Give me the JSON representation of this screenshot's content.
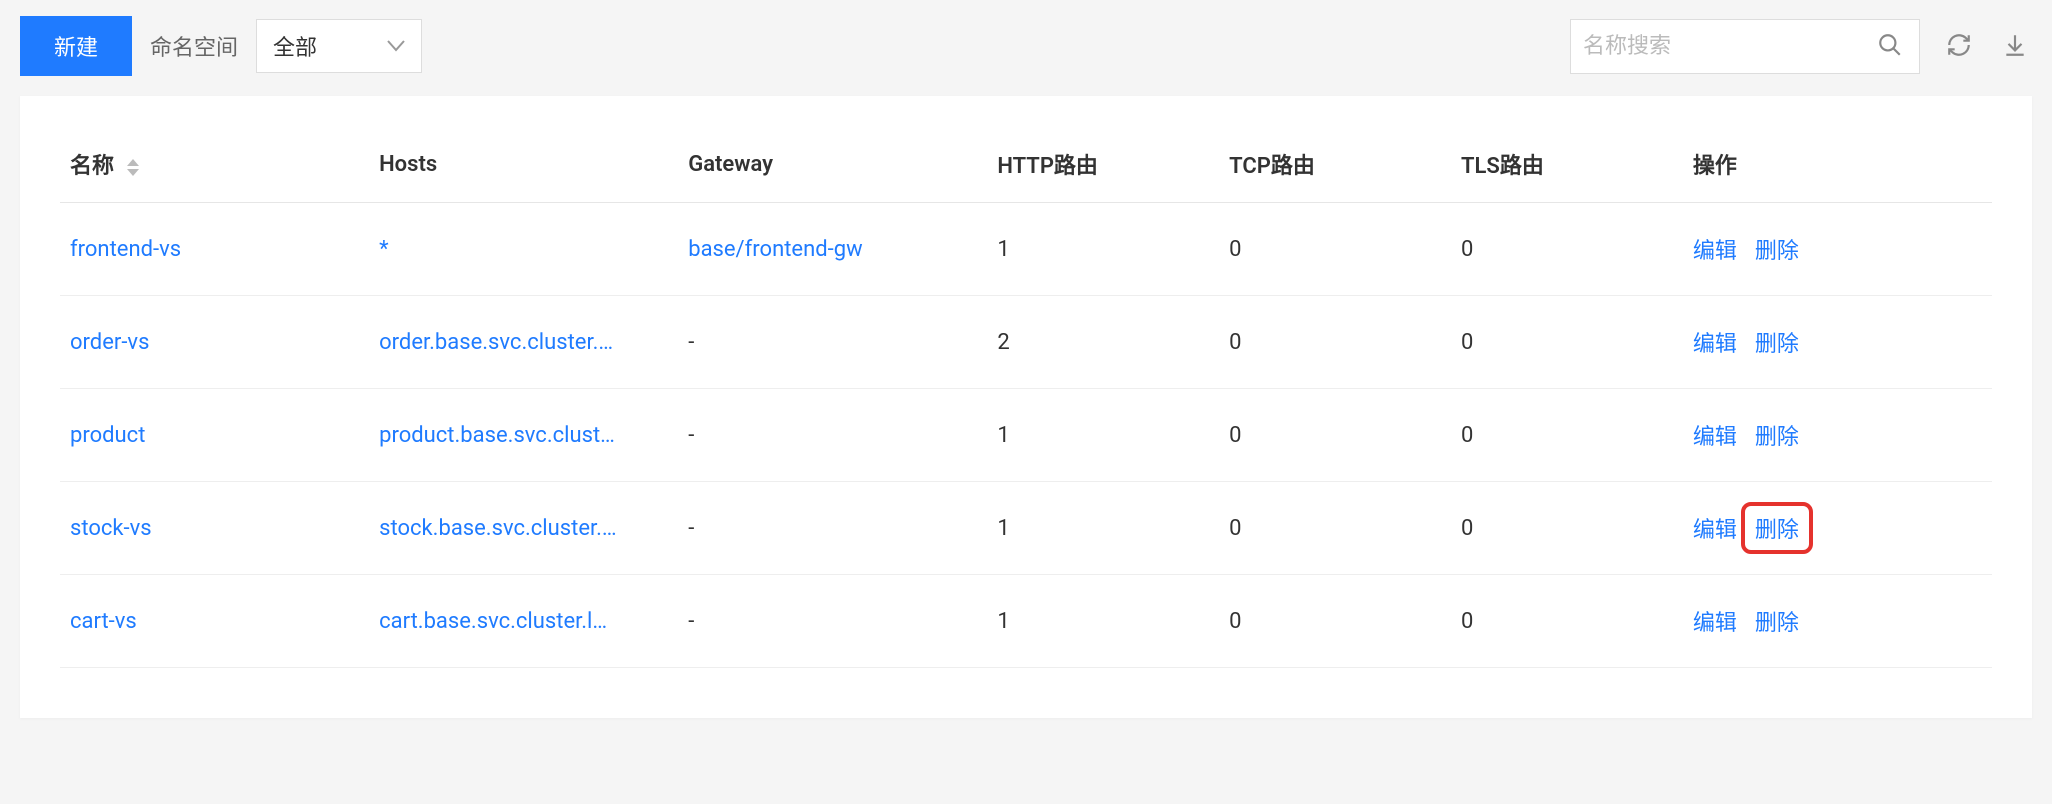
{
  "toolbar": {
    "new_button": "新建",
    "namespace_label": "命名空间",
    "namespace_value": "全部",
    "search_placeholder": "名称搜索"
  },
  "table": {
    "headers": {
      "name": "名称",
      "hosts": "Hosts",
      "gateway": "Gateway",
      "http": "HTTP路由",
      "tcp": "TCP路由",
      "tls": "TLS路由",
      "ops": "操作"
    },
    "actions": {
      "edit": "编辑",
      "delete": "删除"
    },
    "rows": [
      {
        "name": "frontend-vs",
        "hosts": "*",
        "gateway": "base/frontend-gw",
        "gateway_link": true,
        "http": "1",
        "tcp": "0",
        "tls": "0",
        "highlight_delete": false
      },
      {
        "name": "order-vs",
        "hosts": "order.base.svc.cluster.…",
        "gateway": "-",
        "gateway_link": false,
        "http": "2",
        "tcp": "0",
        "tls": "0",
        "highlight_delete": false
      },
      {
        "name": "product",
        "hosts": "product.base.svc.clust…",
        "gateway": "-",
        "gateway_link": false,
        "http": "1",
        "tcp": "0",
        "tls": "0",
        "highlight_delete": false
      },
      {
        "name": "stock-vs",
        "hosts": "stock.base.svc.cluster.…",
        "gateway": "-",
        "gateway_link": false,
        "http": "1",
        "tcp": "0",
        "tls": "0",
        "highlight_delete": true
      },
      {
        "name": "cart-vs",
        "hosts": "cart.base.svc.cluster.l…",
        "gateway": "-",
        "gateway_link": false,
        "http": "1",
        "tcp": "0",
        "tls": "0",
        "highlight_delete": false
      }
    ]
  }
}
